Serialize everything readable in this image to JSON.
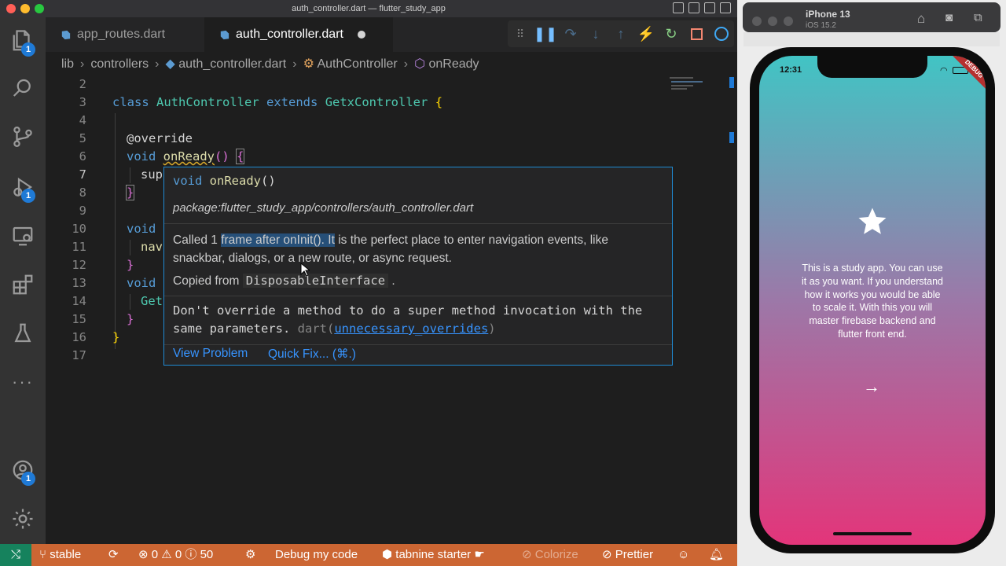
{
  "window": {
    "title": "auth_controller.dart — flutter_study_app"
  },
  "activity_bar": {
    "explorer_badge": "1",
    "debug_badge": "1",
    "account_badge": "1",
    "more": "···"
  },
  "tabs": [
    {
      "label": "app_routes.dart"
    },
    {
      "label": "auth_controller.dart"
    }
  ],
  "breadcrumb": [
    "lib",
    "controllers",
    "auth_controller.dart",
    "AuthController",
    "onReady"
  ],
  "editor": {
    "line_numbers": [
      "2",
      "3",
      "4",
      "5",
      "6",
      "7",
      "8",
      "9",
      "10",
      "11",
      "12",
      "13",
      "14",
      "15",
      "16",
      "17"
    ],
    "line3": {
      "kw1": "class",
      "name": "AuthController",
      "kw2": "extends",
      "parent": "GetxController",
      "brace": "{"
    },
    "line5": "@override",
    "line6": {
      "kw": "void",
      "fn": "onReady",
      "parens": "()",
      "brace": "{"
    },
    "line7": "sup",
    "line8": "}",
    "line10": "void",
    "line11": "nav",
    "line12": "}",
    "line13": "void",
    "line14": "Get",
    "line15": "}",
    "line16": "}"
  },
  "hover": {
    "signature": {
      "kw": "void",
      "fn": "onReady",
      "parens": "()"
    },
    "package_path": "package:flutter_study_app/controllers/auth_controller.dart",
    "doc_pre": "Called 1 ",
    "doc_highlight": "frame after onInit(). It",
    "doc_post": " is the perfect place to enter navigation events, like",
    "doc_line2": "snackbar, dialogs, or a new route, or async request.",
    "copied_from_label": "Copied from",
    "copied_from_value": "DisposableInterface",
    "copied_from_end": ".",
    "lint_line1": "Don't override a method to do a super method invocation with the",
    "lint_line2_pre": "same parameters.",
    "lint_source": "dart(",
    "lint_code": "unnecessary_overrides",
    "lint_close": ")",
    "view_problem": "View Problem",
    "quick_fix": "Quick Fix... (⌘.)"
  },
  "status_bar": {
    "branch": "stable",
    "errors": "0",
    "warnings": "0",
    "infos": "50",
    "debug": "Debug my code",
    "tabnine": "tabnine starter",
    "colorize": "Colorize",
    "prettier": "Prettier"
  },
  "simulator": {
    "device": "iPhone 13",
    "os": "iOS 15.2",
    "time": "12:31",
    "debug_banner": "DEBUG",
    "body": "This is a study app. You can use it as you want. If you understand how it works you would be able to scale it. With this you will master firebase backend and flutter front end."
  },
  "colors": {
    "accent": "#1f8ad2",
    "status_bar": "#cc6633",
    "remote": "#16825d",
    "gradient_top": "#41c4c4",
    "gradient_bottom": "#e3357a"
  }
}
